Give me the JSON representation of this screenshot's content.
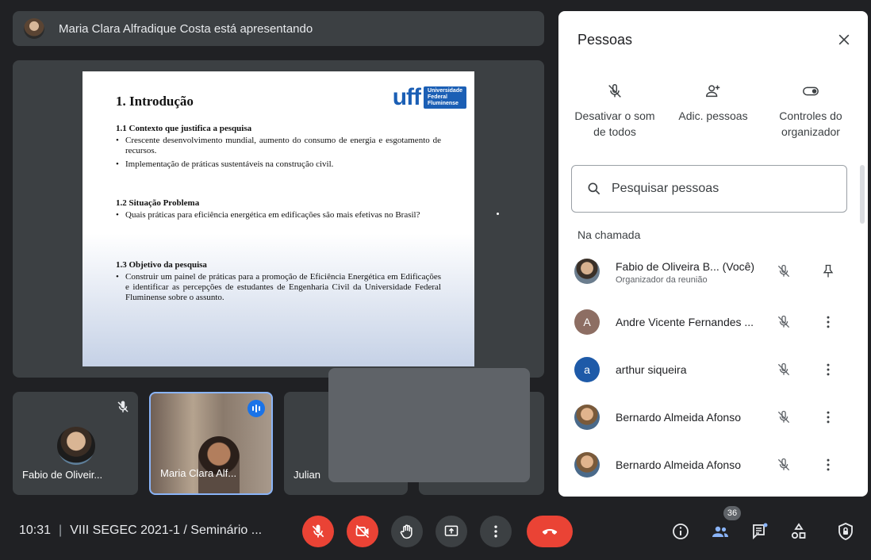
{
  "presenter": {
    "text": "Maria Clara Alfradique Costa está apresentando"
  },
  "slide": {
    "title": "1. Introdução",
    "logo_mark": "uff",
    "logo_lines": [
      "Universidade",
      "Federal",
      "Fluminense"
    ],
    "sections": [
      {
        "heading": "1.1 Contexto que justifica a pesquisa",
        "bullets": [
          "Crescente desenvolvimento mundial, aumento do consumo de energia e esgotamento de recursos.",
          "Implementação de práticas sustentáveis na construção civil."
        ]
      },
      {
        "heading": "1.2 Situação Problema",
        "bullets": [
          "Quais práticas para eficiência energética em edificações são mais efetivas no Brasil?"
        ]
      },
      {
        "heading": "1.3 Objetivo da pesquisa",
        "bullets": [
          "Construir um painel de práticas para a promoção de Eficiência Energética em Edificações e identificar as percepções de estudantes de Engenharia Civil da Universidade Federal Fluminense sobre o assunto."
        ]
      }
    ]
  },
  "tiles": {
    "fabio": "Fabio de Oliveir...",
    "maria": "Maria Clara Alf...",
    "julian": "Julian"
  },
  "panel": {
    "title": "Pessoas",
    "actions": {
      "mute_all": "Desativar o som de todos",
      "add_people": "Adic. pessoas",
      "host_controls": "Controles do organizador"
    },
    "search_placeholder": "Pesquisar pessoas",
    "section_label": "Na chamada",
    "people": [
      {
        "name": "Fabio de Oliveira B...",
        "suffix": "(Você)",
        "role": "Organizador da reunião",
        "avatar_letter": ""
      },
      {
        "name": "Andre Vicente Fernandes ...",
        "avatar_letter": "A",
        "avatar_color": "#8d6e63"
      },
      {
        "name": "arthur siqueira",
        "avatar_letter": "a",
        "avatar_color": "#1e5aa8"
      },
      {
        "name": "Bernardo Almeida Afonso",
        "avatar_letter": ""
      },
      {
        "name": "Bernardo Almeida Afonso",
        "avatar_letter": ""
      }
    ]
  },
  "bottombar": {
    "time": "10:31",
    "meeting_name": "VIII SEGEC 2021-1 / Seminário ...",
    "participant_count": "36"
  },
  "colors": {
    "background": "#202124",
    "tile": "#3c4043",
    "danger": "#ea4335",
    "accent": "#1a73e8"
  },
  "icons": [
    "mic-off-icon",
    "camera-off-icon",
    "raise-hand-icon",
    "present-icon",
    "more-vert-icon",
    "hangup-icon",
    "info-icon",
    "people-icon",
    "chat-icon",
    "activities-icon",
    "lock-icon",
    "close-icon",
    "search-icon",
    "person-add-icon",
    "toggle-icon",
    "pin-icon"
  ]
}
